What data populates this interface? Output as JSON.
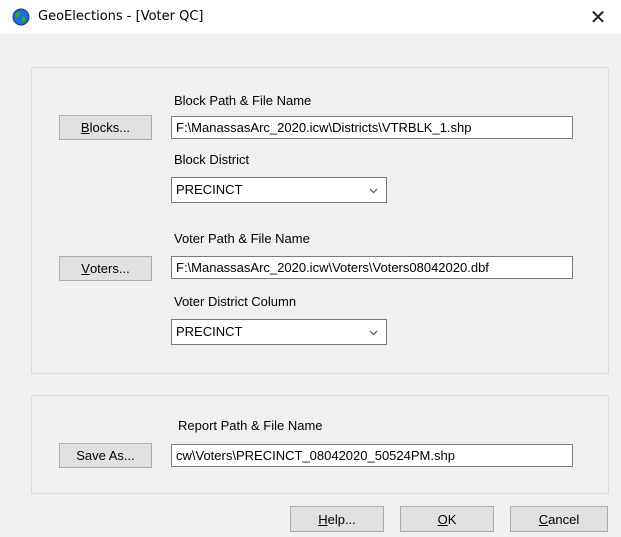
{
  "window": {
    "title": "GeoElections - [Voter QC]",
    "close_symbol": "✕"
  },
  "blocks": {
    "button_accel": "B",
    "button_rest": "locks...",
    "path_label": "Block Path & File Name",
    "path_value": "F:\\ManassasArc_2020.icw\\Districts\\VTRBLK_1.shp",
    "district_label": "Block District",
    "district_value": "PRECINCT"
  },
  "voters": {
    "button_accel": "V",
    "button_rest": "oters...",
    "path_label": "Voter Path & File Name",
    "path_value": "F:\\ManassasArc_2020.icw\\Voters\\Voters08042020.dbf",
    "district_label": "Voter District Column",
    "district_value": "PRECINCT"
  },
  "report": {
    "button_label": "Save As...",
    "path_label": "Report Path & File Name",
    "path_value": "cw\\Voters\\PRECINCT_08042020_50524PM.shp"
  },
  "footer": {
    "help_accel": "H",
    "help_rest": "elp...",
    "ok_accel": "O",
    "ok_rest": "K",
    "cancel_accel": "C",
    "cancel_rest": "ancel"
  },
  "colors": {
    "globe_blue": "#1f6fd1",
    "globe_green": "#3aa63a"
  }
}
